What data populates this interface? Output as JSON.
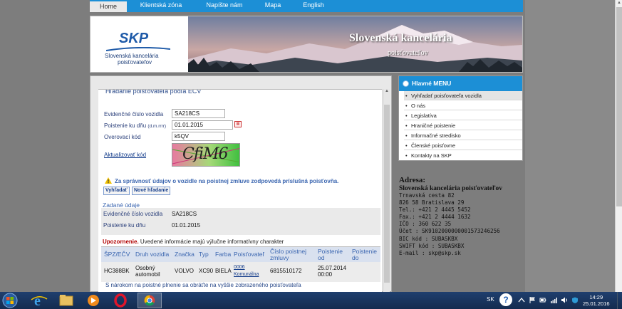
{
  "nav": {
    "items": [
      "Home",
      "Klientská zóna",
      "Napíšte nám",
      "Mapa",
      "English"
    ],
    "active": "Home"
  },
  "banner": {
    "logo_text": "SKP",
    "logo_line1": "Slovenská kancelária",
    "logo_line2": "poisťovateľov",
    "title": "Slovenská kancelária",
    "subtitle": "poisťovateľov"
  },
  "form": {
    "heading": "Hľadanie poisťovateľa podľa EČV",
    "plate_label": "Evidenčné číslo vozidla",
    "plate_value": "SA218CS",
    "date_label": "Poistenie ku dňu",
    "date_hint": "(d.m.rrrr)",
    "date_value": "01.01.2015",
    "code_label": "Overovací kód",
    "code_value": "k5QV",
    "captcha_text": "CfiM6",
    "refresh_link": "Aktualizovať kód",
    "warning": "Za správnosť údajov o vozidle na poistnej zmluve zodpovedá príslušná poisťovňa.",
    "search_button": "Vyhľadať",
    "new_search_button": "Nové hľadanie"
  },
  "entered": {
    "title": "Zadané údaje",
    "plate_label": "Evidenčné číslo vozidla",
    "plate_value": "SA218CS",
    "date_label": "Poistenie ku dňu",
    "date_value": "01.01.2015"
  },
  "notice": {
    "strong": "Upozornenie.",
    "text": "Uvedené informácie majú výlučne informatívny charakter"
  },
  "results": {
    "columns": [
      "ŠPZ/EČV",
      "Druh vozidla",
      "Značka",
      "Typ",
      "Farba",
      "Poisťovateľ",
      "Číslo poistnej zmluvy",
      "Poistenie od",
      "Poistenie do"
    ],
    "rows": [
      {
        "plate": "HC388BK",
        "kind": "Osobný automobil",
        "brand": "VOLVO",
        "type": "XC90",
        "color": "BIELA",
        "insurer_code": "0006",
        "insurer_name": "Komunálna",
        "policy": "6815510172",
        "from": "25.07.2014 00:00",
        "to": ""
      }
    ]
  },
  "claim_note": "S nárokom na poistné plnenie sa obráťte na vyššie zobrazeného poisťovateľa",
  "menu": {
    "title": "Hlavné MENU",
    "items": [
      "Vyhľadať poisťovateľa vozidla",
      "O nás",
      "Legislatíva",
      "Hraničné poistenie",
      "Informačné stredisko",
      "Členské poisťovne",
      "Kontakty na SKP"
    ],
    "active_index": 0
  },
  "address": {
    "title": "Adresa:",
    "name": "Slovenská kancelária poisťovateľov",
    "lines": [
      "Trnavská cesta 82",
      "826 58 Bratislava 29",
      "Tel.: +421 2 4445 5452",
      "Fax.: +421 2 4444 1632",
      "IČO : 360 622 35",
      "Účet : SK9102000000001573246256",
      "BIC kód : SUBASKBX",
      "SWIFT kód : SUBASKBX",
      "E-mail : skp@skp.sk"
    ]
  },
  "taskbar": {
    "apps": [
      "internet-explorer",
      "file-explorer",
      "media-player",
      "opera",
      "chrome"
    ],
    "active_app": "chrome",
    "lang": "SK",
    "help": "?",
    "time": "14:29",
    "date": "25.01.2016"
  },
  "colors": {
    "accent": "#1c8fd6",
    "link": "#123b8a",
    "warning_text": "#3b66b0",
    "notice_red": "#b00000"
  }
}
